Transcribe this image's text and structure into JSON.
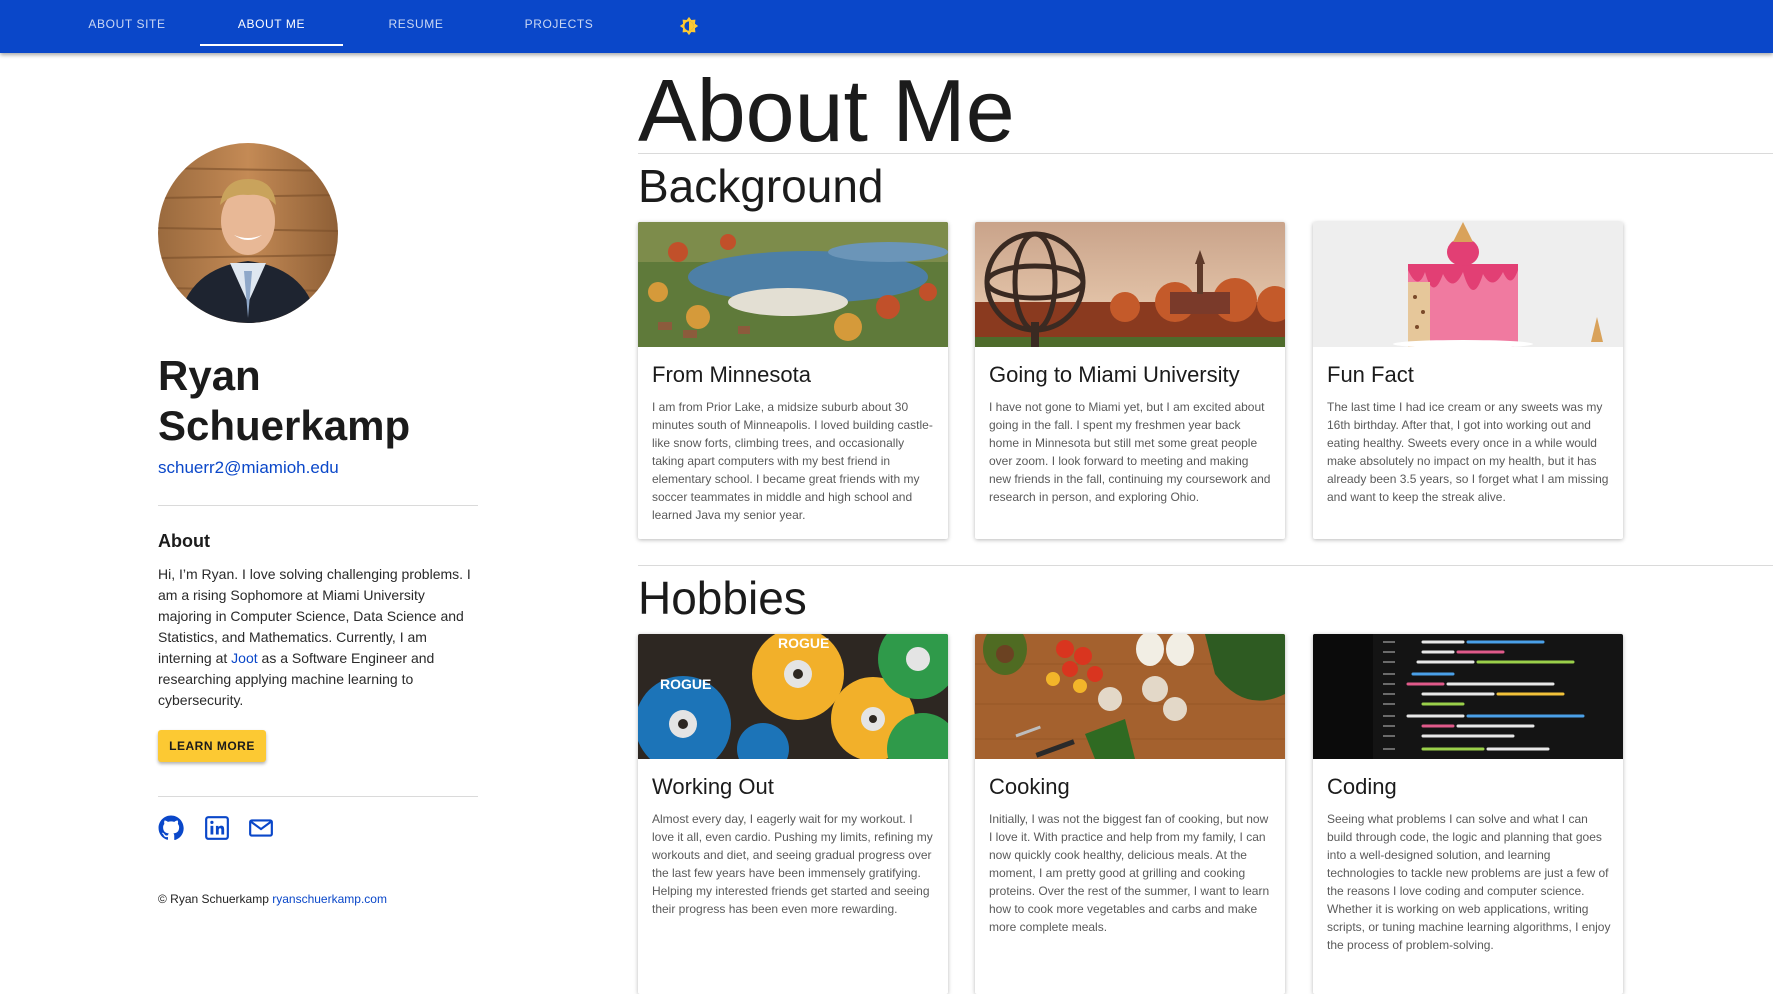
{
  "nav": {
    "items": [
      {
        "label": "ABOUT SITE"
      },
      {
        "label": "ABOUT ME"
      },
      {
        "label": "RESUME"
      },
      {
        "label": "PROJECTS"
      }
    ],
    "active": "ABOUT ME",
    "accent_color": "#0a47c9",
    "toggle_icon": "brightness-icon"
  },
  "profile": {
    "name": "Ryan Schuerkamp",
    "email": "schuerr2@miamioh.edu",
    "about_heading": "About",
    "about_text_before_link": "Hi, I’m Ryan. I love solving challenging problems. I am a rising Sophomore at Miami University majoring in Computer Science, Data Science and Statistics, and Mathematics. Currently, I am interning at ",
    "about_link": "Joot",
    "about_text_after_link": " as a Software Engineer and researching applying machine learning to cybersecurity.",
    "learn_more_label": "LEARN MORE",
    "social_icons": [
      "github-icon",
      "linkedin-icon",
      "mail-icon"
    ]
  },
  "footer": {
    "copyright": "© Ryan Schuerkamp",
    "link": "ryanschuerkamp.com"
  },
  "main": {
    "title": "About Me",
    "sections": [
      {
        "heading": "Background",
        "cards": [
          {
            "title": "From Minnesota",
            "text": "I am from Prior Lake, a midsize suburb about 30 minutes south of Minneapolis. I loved building castle-like snow forts, climbing trees, and occasionally taking apart computers with my best friend in elementary school. I became great friends with my soccer teammates in middle and high school and learned Java my senior year."
          },
          {
            "title": "Going to Miami University",
            "text": "I have not gone to Miami yet, but I am excited about going in the fall. I spent my freshmen year back home in Minnesota but still met some great people over zoom. I look forward to meeting and making new friends in the fall, continuing my coursework and research in person, and exploring Ohio."
          },
          {
            "title": "Fun Fact",
            "text": "The last time I had ice cream or any sweets was my 16th birthday. After that, I got into working out and eating healthy. Sweets every once in a while would make absolutely no impact on my health, but it has already been 3.5 years, so I forget what I am missing and want to keep the streak alive."
          }
        ]
      },
      {
        "heading": "Hobbies",
        "cards": [
          {
            "title": "Working Out",
            "text": "Almost every day, I eagerly wait for my workout. I love it all, even cardio. Pushing my limits, refining my workouts and diet, and seeing gradual progress over the last few years have been immensely gratifying. Helping my interested friends get started and seeing their progress has been even more rewarding."
          },
          {
            "title": "Cooking",
            "text": "Initially, I was not the biggest fan of cooking, but now I love it. With practice and help from my family, I can now quickly cook healthy, delicious meals. At the moment, I am pretty good at grilling and cooking proteins. Over the rest of the summer, I want to learn how to cook more vegetables and carbs and make more complete meals."
          },
          {
            "title": "Coding",
            "text": "Seeing what problems I can solve and what I can build through code, the logic and planning that goes into a well-designed solution, and learning technologies to tackle new problems are just a few of the reasons I love coding and computer science. Whether it is working on web applications, writing scripts, or tuning machine learning algorithms, I enjoy the process of problem-solving."
          }
        ]
      }
    ]
  },
  "colors": {
    "nav_bg": "#0a47c9",
    "button_bg": "#fcc933",
    "link": "#0a47c9"
  }
}
